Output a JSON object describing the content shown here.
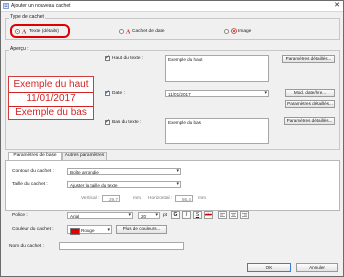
{
  "window": {
    "title": "Ajouter un nouveau cachet",
    "close_glyph": "✕"
  },
  "type_section": {
    "label": "Type de cachet",
    "options": [
      {
        "label": "Texte (détails)",
        "selected": true,
        "icon": "text-stamp-icon"
      },
      {
        "label": "Cachet de date",
        "selected": false,
        "icon": "date-stamp-icon"
      },
      {
        "label": "Image",
        "selected": false,
        "icon": "image-stamp-icon"
      }
    ]
  },
  "preview_section": {
    "label": "Aperçu :",
    "lines": [
      "Exemple du haut",
      "11/01/2017",
      "Exemple du bas"
    ],
    "color": "#d12424"
  },
  "fields": {
    "top": {
      "checkbox_label": "Haut du texte :",
      "checked": true,
      "value": "Exemple du haut",
      "button": "Paramètres détaillés..."
    },
    "date": {
      "checkbox_label": "Date :",
      "checked": true,
      "value": "11/01/2017",
      "button_format": "Mod. date/hre...",
      "button_detail": "Paramètres détaillés..."
    },
    "bottom": {
      "checkbox_label": "Bas du texte :",
      "checked": true,
      "value": "Exemple du bas",
      "button": "Paramètres détaillés..."
    }
  },
  "tabs": [
    {
      "label": "Paramètres de base",
      "active": true
    },
    {
      "label": "Autres paramètres",
      "active": false
    }
  ],
  "basic": {
    "contour_label": "Contour du cachet :",
    "contour_value": "Boîte arrondie",
    "size_label": "Taille du cachet :",
    "size_value": "Ajuster la taille du texte",
    "vertical_label": "Vertical :",
    "vertical_value": "29,7",
    "horizontal_label": "Horizontal :",
    "horizontal_value": "86,4",
    "unit": "mm",
    "font_label": "Police :",
    "font_value": "Arial",
    "font_size": "20",
    "font_size_unit": "pt",
    "format_buttons": [
      "G",
      "I",
      "S",
      "abc"
    ],
    "color_label": "Couleur du cachet :",
    "color_value": "Rouge",
    "color_swatch": "#e00000",
    "more_colors": "Plus de couleurs..."
  },
  "name_label": "Nom du cachet :",
  "name_value": "",
  "ok": "OK",
  "cancel": "Annuler"
}
